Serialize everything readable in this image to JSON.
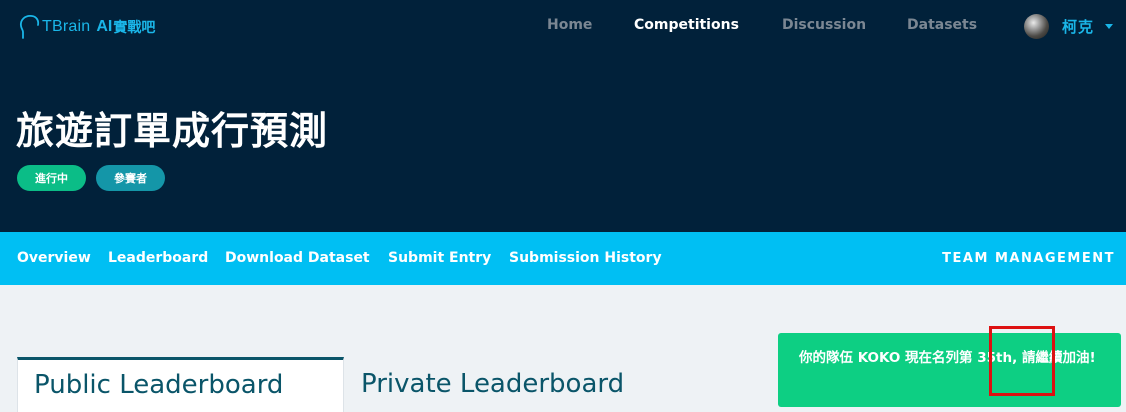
{
  "brand": {
    "tbrain": "TBrain",
    "ai": "AI",
    "cn": "實戰吧"
  },
  "nav": {
    "home": "Home",
    "competitions": "Competitions",
    "discussion": "Discussion",
    "datasets": "Datasets",
    "user_name": "柯克"
  },
  "competition": {
    "title": "旅遊訂單成行預測",
    "status_badge": "進行中",
    "role_badge": "參賽者"
  },
  "tabs": {
    "overview": "Overview",
    "leaderboard": "Leaderboard",
    "download": "Download Dataset",
    "submit": "Submit Entry",
    "history": "Submission History",
    "team": "TEAM MANAGEMENT"
  },
  "leaderboard_tabs": {
    "public": "Public Leaderboard",
    "private": "Private Leaderboard"
  },
  "rank_notice": {
    "text": "你的隊伍 KOKO 現在名列第 35th, 請繼續加油!"
  },
  "colors": {
    "hero_bg": "#01213a",
    "accent_blue": "#00bff3",
    "green": "#0dcf83",
    "highlight_red": "#dd1111"
  }
}
